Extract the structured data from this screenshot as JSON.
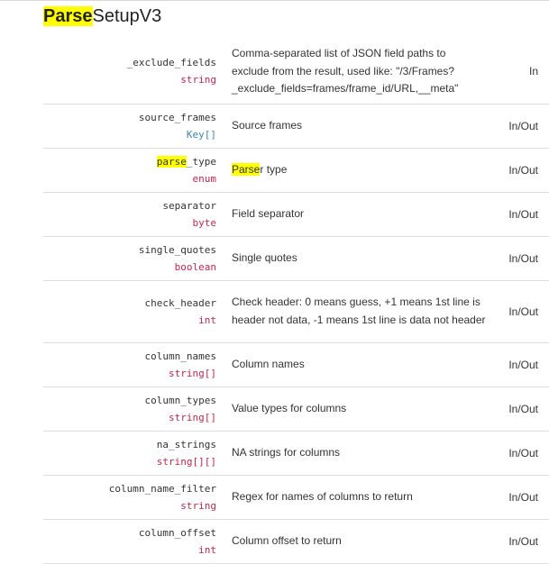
{
  "page": {
    "title_highlight": "Parse",
    "title_rest": "SetupV3"
  },
  "colors": {
    "highlight": "#ffff00",
    "type_text": "#c7254e",
    "key_type_text": "#3a87ad",
    "row_border": "#dddddd"
  },
  "fields": [
    {
      "name": "_exclude_fields",
      "type": "string",
      "description": "Comma-separated list of JSON field paths to exclude from the result, used like: \"/3/Frames?_exclude_fields=frames/frame_id/URL,__meta\"",
      "direction": "In"
    },
    {
      "name": "source_frames",
      "type": "Key[]",
      "description": "Source frames",
      "direction": "In/Out"
    },
    {
      "name_highlight": "parse",
      "name_rest": "_type",
      "type": "enum",
      "desc_highlight": "Parse",
      "desc_rest": "r type",
      "direction": "In/Out"
    },
    {
      "name": "separator",
      "type": "byte",
      "description": "Field separator",
      "direction": "In/Out"
    },
    {
      "name": "single_quotes",
      "type": "boolean",
      "description": "Single quotes",
      "direction": "In/Out"
    },
    {
      "name": "check_header",
      "type": "int",
      "description": "Check header: 0 means guess, +1 means 1st line is header not data, -1 means 1st line is data not header",
      "direction": "In/Out"
    },
    {
      "name": "column_names",
      "type": "string[]",
      "description": "Column names",
      "direction": "In/Out"
    },
    {
      "name": "column_types",
      "type": "string[]",
      "description": "Value types for columns",
      "direction": "In/Out"
    },
    {
      "name": "na_strings",
      "type": "string[][]",
      "description": "NA strings for columns",
      "direction": "In/Out"
    },
    {
      "name": "column_name_filter",
      "type": "string",
      "description": "Regex for names of columns to return",
      "direction": "In/Out"
    },
    {
      "name": "column_offset",
      "type": "int",
      "description": "Column offset to return",
      "direction": "In/Out"
    }
  ]
}
